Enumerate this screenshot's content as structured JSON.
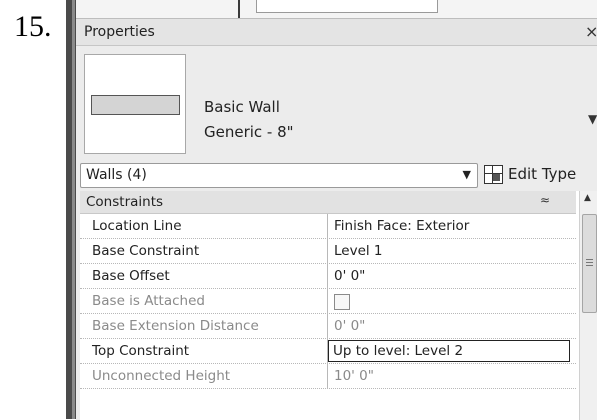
{
  "step_number": "15.",
  "panel": {
    "title": "Properties",
    "close_symbol": "×"
  },
  "type_selector": {
    "family": "Basic Wall",
    "type": "Generic - 8\"",
    "dropdown_symbol": "▼"
  },
  "instance_filter": {
    "selected": "Walls (4)",
    "arrow_symbol": "▼",
    "edit_type_label": "Edit Type"
  },
  "group": {
    "name": "Constraints",
    "collapse_symbol": "≈"
  },
  "properties": [
    {
      "name": "Location Line",
      "value": "Finish Face: Exterior"
    },
    {
      "name": "Base Constraint",
      "value": "Level 1"
    },
    {
      "name": "Base Offset",
      "value": "0'  0\""
    },
    {
      "name": "Base is Attached",
      "value": ""
    },
    {
      "name": "Base Extension Distance",
      "value": "0'  0\""
    },
    {
      "name": "Top Constraint",
      "value": "Up to level: Level 2"
    },
    {
      "name": "Unconnected Height",
      "value": "10'  0\""
    }
  ],
  "icons": {
    "close": "close-icon",
    "edit_type": "edit-type-icon",
    "collapse": "collapse-icon",
    "scroll_up": "scroll-up-icon"
  },
  "colors": {
    "panel_bg": "#ececec",
    "grid_bg": "#ffffff",
    "disabled_text": "#8a8a8a",
    "frame": "#4a4a4a"
  }
}
